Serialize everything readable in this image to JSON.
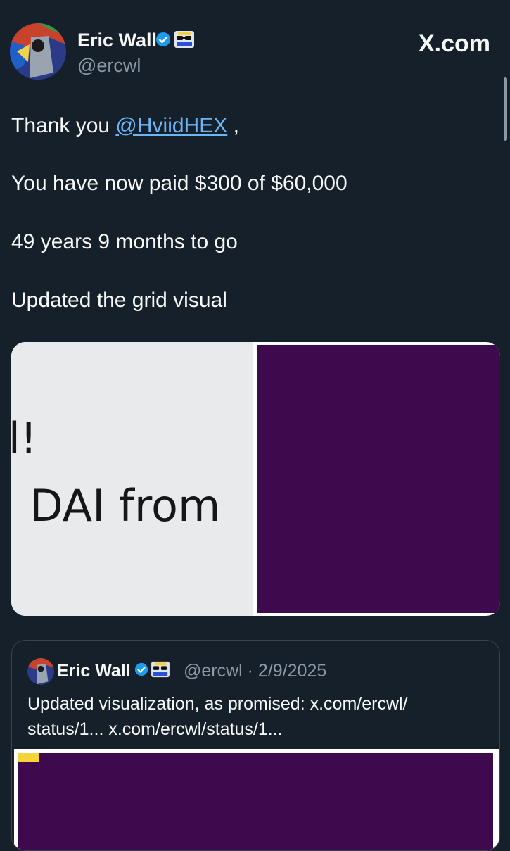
{
  "author": {
    "name": "Eric Wall",
    "handle": "@ercwl"
  },
  "brand": "X.com",
  "tweet": {
    "line1_prefix": "Thank you ",
    "line1_mention": "@HviidHEX",
    "line1_suffix": " ,",
    "line2": "You have now paid $300 of $60,000",
    "line3": "49 years 9 months to go",
    "line4": "Updated the grid visual"
  },
  "media": {
    "left_crop_line1": "l!",
    "left_crop_line2": "DAI from"
  },
  "quote": {
    "name": "Eric Wall",
    "meta": "@ercwl · 2/9/2025",
    "text": "Updated visualization, as promised: x.com/ercwl/ status/1... x.com/ercwl/status/1..."
  },
  "colors": {
    "background": "#15202b",
    "link": "#6cb6f8",
    "verified": "#1d9bf0",
    "grid_purple": "#3f0a4d",
    "grid_filled": "#f5d33b"
  },
  "icons": [
    "verified-badge-icon",
    "sunglasses-emoji-icon",
    "x-logo"
  ]
}
